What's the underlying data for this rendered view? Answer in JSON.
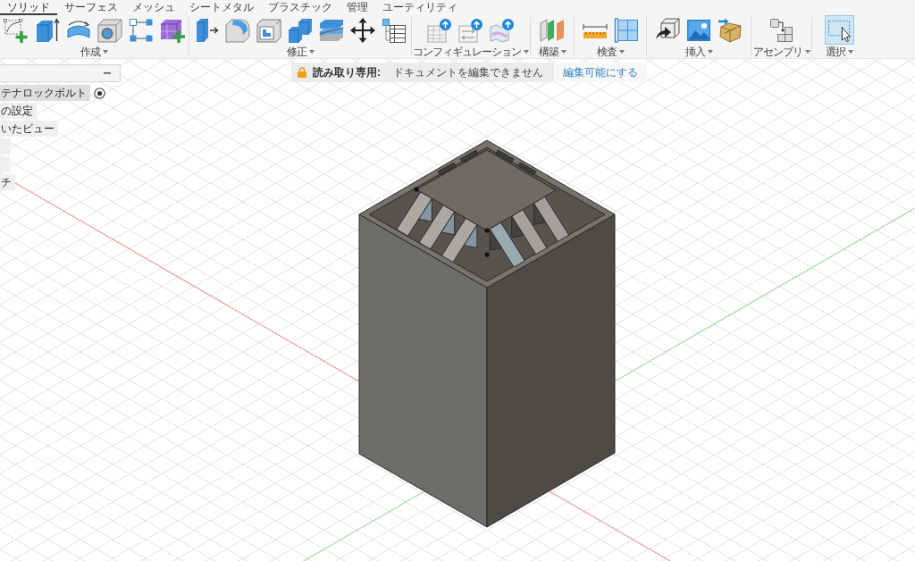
{
  "ribbon": {
    "tabs": [
      {
        "label": "ソリッド",
        "selected": true
      },
      {
        "label": "サーフェス",
        "selected": false
      },
      {
        "label": "メッシュ",
        "selected": false
      },
      {
        "label": "シートメタル",
        "selected": false
      },
      {
        "label": "プラスチック",
        "selected": false
      },
      {
        "label": "管理",
        "selected": false
      },
      {
        "label": "ユーティリティ",
        "selected": false
      }
    ],
    "groups": [
      {
        "label": "作成",
        "tools": [
          {
            "kind": "sketch",
            "selected": false
          },
          {
            "kind": "extrude",
            "selected": false
          },
          {
            "kind": "revolve",
            "selected": false
          },
          {
            "kind": "hole",
            "selected": false
          },
          {
            "kind": "pattern",
            "selected": false
          },
          {
            "kind": "form",
            "selected": false
          }
        ]
      },
      {
        "label": "修正",
        "tools": [
          {
            "kind": "presspull",
            "selected": false
          },
          {
            "kind": "fillet",
            "selected": false
          },
          {
            "kind": "shell",
            "selected": false
          },
          {
            "kind": "combine",
            "selected": false
          },
          {
            "kind": "split",
            "selected": false
          },
          {
            "kind": "move",
            "selected": false
          },
          {
            "kind": "parameters",
            "selected": false
          }
        ]
      },
      {
        "label": "コンフィギュレーション",
        "tools": [
          {
            "kind": "configtable",
            "selected": false
          },
          {
            "kind": "configrule",
            "selected": false
          },
          {
            "kind": "configtheme",
            "selected": false
          }
        ]
      },
      {
        "label": "構築",
        "tools": [
          {
            "kind": "plane",
            "selected": false
          }
        ]
      },
      {
        "label": "検査",
        "tools": [
          {
            "kind": "measure",
            "selected": false
          },
          {
            "kind": "section",
            "selected": false
          }
        ]
      },
      {
        "label": "挿入",
        "tools": [
          {
            "kind": "derive",
            "selected": false
          },
          {
            "kind": "image",
            "selected": false
          },
          {
            "kind": "mesh",
            "selected": false
          }
        ]
      },
      {
        "label": "アセンブリ",
        "tools": [
          {
            "kind": "joint",
            "selected": false
          }
        ]
      },
      {
        "label": "選択",
        "tools": [
          {
            "kind": "select",
            "selected": true
          }
        ]
      }
    ]
  },
  "browser": {
    "items": [
      {
        "label": "テナロックボルト",
        "active": true
      },
      {
        "label": "の設定",
        "active": false
      },
      {
        "label": "いたビュー",
        "active": false
      },
      {
        "active": false
      },
      {
        "active": false
      },
      {
        "label": "チ",
        "active": false
      }
    ]
  },
  "banner": {
    "title": "読み取り専用:",
    "message": "ドキュメントを編集できません",
    "link": "編集可能にする"
  }
}
